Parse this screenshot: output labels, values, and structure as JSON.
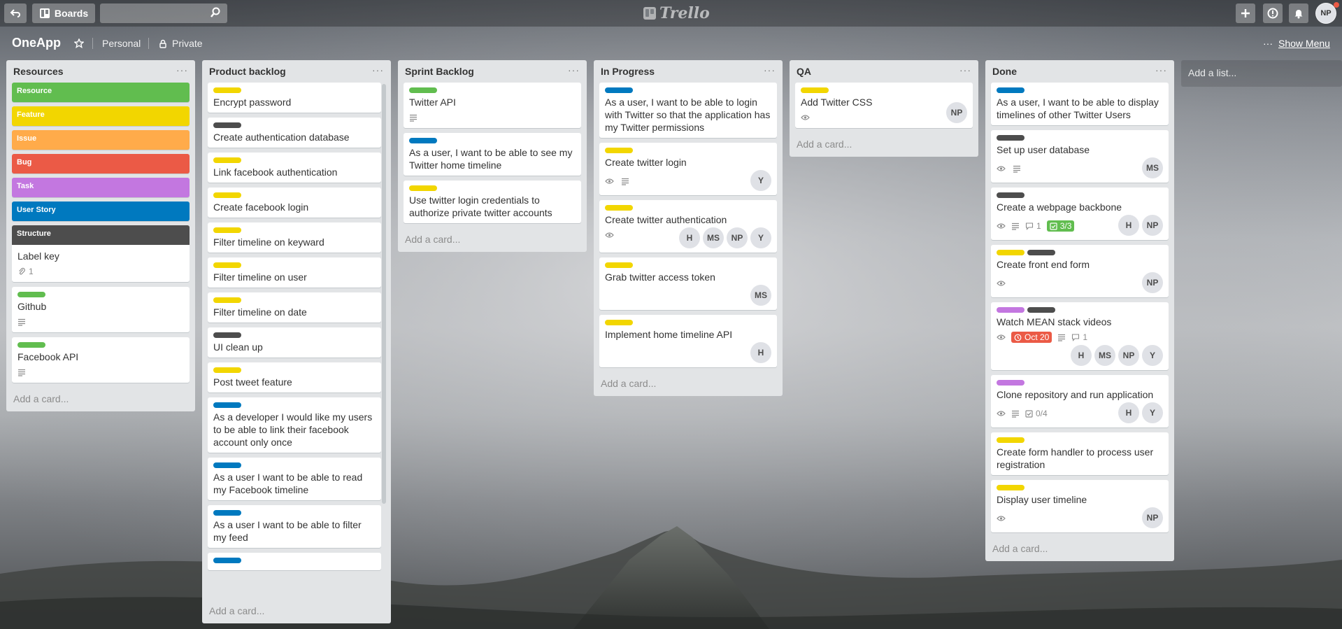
{
  "header": {
    "boards_label": "Boards",
    "logo_text": "Trello",
    "avatar_initials": "NP"
  },
  "board": {
    "title": "OneApp",
    "team": "Personal",
    "visibility": "Private",
    "show_menu": "Show Menu"
  },
  "lists": [
    {
      "title": "Resources",
      "label_cards": [
        {
          "text": "Resource",
          "color": "#61bd4f"
        },
        {
          "text": "Feature",
          "color": "#f2d600"
        },
        {
          "text": "Issue",
          "color": "#ffab4a"
        },
        {
          "text": "Bug",
          "color": "#eb5a46"
        },
        {
          "text": "Task",
          "color": "#c377e0"
        },
        {
          "text": "User Story",
          "color": "#0079bf"
        },
        {
          "text": "Structure",
          "color": "#4d4d4d"
        }
      ],
      "cards": [
        {
          "title": "Label key",
          "attachments": "1"
        },
        {
          "title": "Github"
        },
        {
          "title": "Facebook API"
        }
      ],
      "add_card": "Add a card..."
    },
    {
      "title": "Product backlog",
      "cards": [
        {
          "title": "Encrypt password"
        },
        {
          "title": "Create authentication database"
        },
        {
          "title": "Link facebook authentication"
        },
        {
          "title": "Create facebook login"
        },
        {
          "title": "Filter timeline on keyward"
        },
        {
          "title": "Filter timeline on user"
        },
        {
          "title": "Filter timeline on date"
        },
        {
          "title": "UI clean up"
        },
        {
          "title": "Post tweet feature"
        },
        {
          "title": "As a developer I would like my users to be able to link their facebook account only once"
        },
        {
          "title": "As a user I want to be able to read my Facebook timeline"
        },
        {
          "title": "As a user I want to be able to filter my feed"
        }
      ],
      "add_card": "Add a card..."
    },
    {
      "title": "Sprint Backlog",
      "cards": [
        {
          "title": "Twitter API"
        },
        {
          "title": "As a user, I want to be able to see my Twitter home timeline"
        },
        {
          "title": "Use twitter login credentials to authorize private twitter accounts"
        }
      ],
      "add_card": "Add a card..."
    },
    {
      "title": "In Progress",
      "cards": [
        {
          "title": "As a user, I want to be able to login with Twitter so that the application has my Twitter permissions"
        },
        {
          "title": "Create twitter login",
          "members": [
            "Y"
          ]
        },
        {
          "title": "Create twitter authentication",
          "members": [
            "H",
            "MS",
            "NP",
            "Y"
          ]
        },
        {
          "title": "Grab twitter access token",
          "members": [
            "MS"
          ]
        },
        {
          "title": "Implement home timeline API",
          "members": [
            "H"
          ]
        }
      ],
      "add_card": "Add a card..."
    },
    {
      "title": "QA",
      "cards": [
        {
          "title": "Add Twitter CSS",
          "members": [
            "NP"
          ]
        }
      ],
      "add_card": "Add a card..."
    },
    {
      "title": "Done",
      "cards": [
        {
          "title": "As a user, I want to be able to display timelines of other Twitter Users"
        },
        {
          "title": "Set up user database",
          "members": [
            "MS"
          ]
        },
        {
          "title": "Create a webpage backbone",
          "comments": "1",
          "checklist": "3/3",
          "members": [
            "H",
            "NP"
          ]
        },
        {
          "title": "Create front end form",
          "members": [
            "NP"
          ]
        },
        {
          "title": "Watch MEAN stack videos",
          "due": "Oct 20",
          "comments": "1",
          "members": [
            "H",
            "MS",
            "NP",
            "Y"
          ]
        },
        {
          "title": "Clone repository and run application",
          "checklist": "0/4",
          "members": [
            "H",
            "Y"
          ]
        },
        {
          "title": "Create form handler to process user registration"
        },
        {
          "title": "Display user timeline",
          "members": [
            "NP"
          ]
        }
      ],
      "add_card": "Add a card..."
    }
  ],
  "add_list": "Add a list..."
}
